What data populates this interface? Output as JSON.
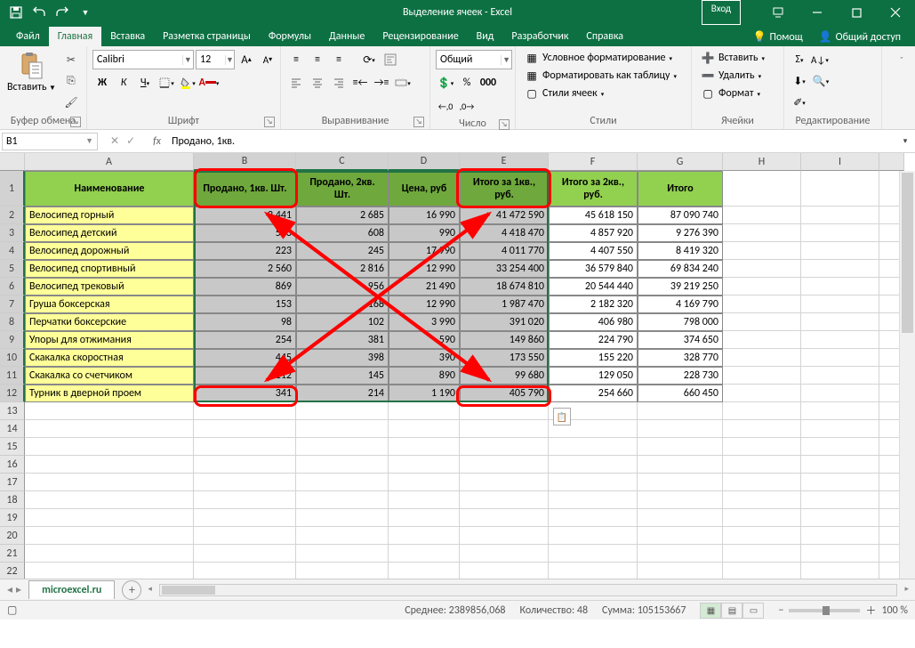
{
  "title": "Выделение ячеек  -  Excel",
  "login": "Вход",
  "tabs": {
    "file": "Файл",
    "home": "Главная",
    "insert": "Вставка",
    "layout": "Разметка страницы",
    "formulas": "Формулы",
    "data": "Данные",
    "review": "Рецензирование",
    "view": "Вид",
    "developer": "Разработчик",
    "help": "Справка",
    "tell": "Помощ",
    "share": "Общий доступ"
  },
  "ribbon": {
    "clipboard": "Буфер обмена",
    "paste": "Вставить",
    "font": "Шрифт",
    "fontName": "Calibri",
    "fontSize": "12",
    "alignment": "Выравнивание",
    "number": "Число",
    "numFormat": "Общий",
    "styles": "Стили",
    "condFmt": "Условное форматирование",
    "fmtTable": "Форматировать как таблицу",
    "cellStyles": "Стили ячеек",
    "cells": "Ячейки",
    "insertBtn": "Вставить",
    "delete": "Удалить",
    "format": "Формат",
    "editing": "Редактирование"
  },
  "nameBox": "B1",
  "formulaBar": "Продано, 1кв.",
  "cols": [
    "A",
    "B",
    "C",
    "D",
    "E",
    "F",
    "G",
    "H",
    "I"
  ],
  "headers": [
    "Наименование",
    "Продано, 1кв. Шт.",
    "Продано, 2кв. Шт.",
    "Цена, руб",
    "Итого за 1кв., руб.",
    "Итого за 2кв., руб.",
    "Итого"
  ],
  "rows": [
    {
      "n": "Велосипед горный",
      "b": "2 441",
      "c": "2 685",
      "d": "16 990",
      "e": "41 472 590",
      "f": "45 618 150",
      "g": "87 090 740"
    },
    {
      "n": "Велосипед детский",
      "b": "553",
      "c": "608",
      "d": "990",
      "e": "4 418 470",
      "f": "4 857 920",
      "g": "9 276 390"
    },
    {
      "n": "Велосипед дорожный",
      "b": "223",
      "c": "245",
      "d": "17 990",
      "e": "4 011 770",
      "f": "4 407 550",
      "g": "8 419 320"
    },
    {
      "n": "Велосипед спортивный",
      "b": "2 560",
      "c": "2 816",
      "d": "12 990",
      "e": "33 254 400",
      "f": "36 579 840",
      "g": "69 834 240"
    },
    {
      "n": "Велосипед трековый",
      "b": "869",
      "c": "956",
      "d": "21 490",
      "e": "18 674 810",
      "f": "20 544 440",
      "g": "39 219 250"
    },
    {
      "n": "Груша боксерская",
      "b": "153",
      "c": "168",
      "d": "12 990",
      "e": "1 987 470",
      "f": "2 182 320",
      "g": "4 169 790"
    },
    {
      "n": "Перчатки боксерские",
      "b": "98",
      "c": "102",
      "d": "3 990",
      "e": "391 020",
      "f": "406 980",
      "g": "798 000"
    },
    {
      "n": "Упоры для отжимания",
      "b": "254",
      "c": "381",
      "d": "590",
      "e": "149 860",
      "f": "224 790",
      "g": "374 650"
    },
    {
      "n": "Скакалка скоростная",
      "b": "445",
      "c": "398",
      "d": "390",
      "e": "173 550",
      "f": "155 220",
      "g": "328 770"
    },
    {
      "n": "Скакалка со счетчиком",
      "b": "112",
      "c": "145",
      "d": "890",
      "e": "99 680",
      "f": "129 050",
      "g": "228 730"
    },
    {
      "n": "Турник в дверной проем",
      "b": "341",
      "c": "214",
      "d": "1 190",
      "e": "405 790",
      "f": "254 660",
      "g": "660 450"
    }
  ],
  "sheetTab": "microexcel.ru",
  "status": {
    "avg": "Среднее: 2389856,068",
    "count": "Количество: 48",
    "sum": "Сумма: 105153667",
    "zoom": "100 %"
  }
}
